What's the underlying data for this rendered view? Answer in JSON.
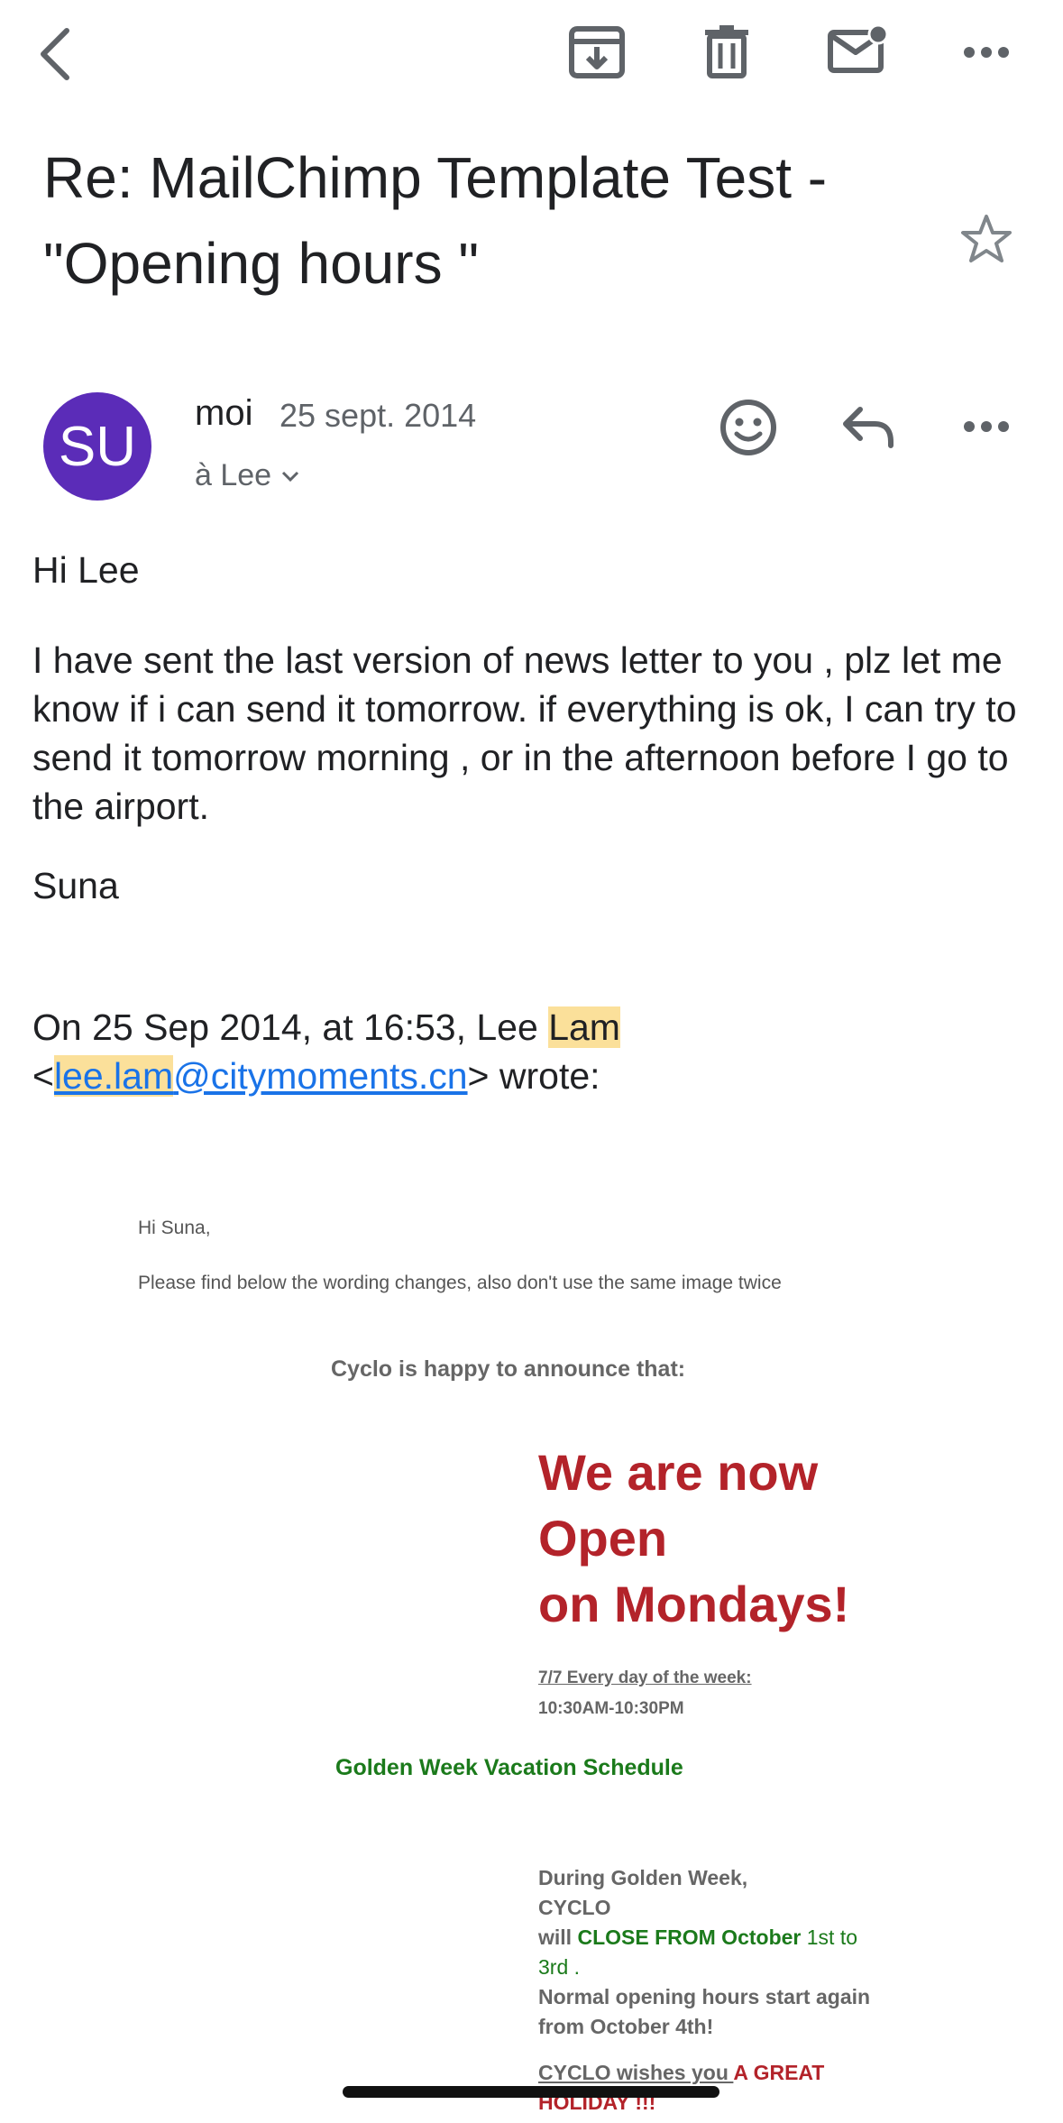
{
  "toolbar": {
    "back": "back-arrow-icon",
    "archive": "archive-icon",
    "delete": "trash-icon",
    "mark_unread": "mail-unread-icon",
    "more": "more-horizontal-icon"
  },
  "email": {
    "subject": "Re: MailChimp Template Test - \"Opening hours \"",
    "avatar_initials": "SU",
    "avatar_color": "#5b2cb8",
    "sender": "moi",
    "date": "25 sept. 2014",
    "recipient": "à Lee",
    "greeting": "Hi Lee",
    "paragraph": "I have sent the last version of news letter to you , plz let me know if i can send it tomorrow. if everything is ok, I can try to send it tomorrow morning , or in the afternoon before I go to the airport.",
    "signature": "Suna",
    "quote_header_prefix": "On 25 Sep 2014, at 16:53, Lee ",
    "quote_header_highlight": "Lam",
    "quote_open": "<",
    "quote_email_hl": "lee.lam",
    "quote_email_rest": "@citymoments.cn",
    "quote_close": "> wrote:"
  },
  "quoted": {
    "greeting": "Hi Suna,",
    "intro": "Please find below the wording changes, also don't use the same image twice",
    "announce": "Cyclo is happy to announce that:",
    "headline_1": "We are now",
    "headline_2": "Open",
    "headline_3": "on Mondays!",
    "hours_label": "7/7 Every day of the week:",
    "hours": "10:30AM-10:30PM",
    "golden_week_title": "Golden Week Vacation Schedule",
    "gw_1": "During Golden Week,",
    "gw_2": "CYCLO",
    "gw_3a": "will ",
    "gw_3b": "CLOSE FROM October",
    "gw_3c": " 1st to",
    "gw_4a": "3rd",
    "gw_4b": " .",
    "gw_5": "Normal opening hours start again",
    "gw_6": "from October 4th!",
    "gw_7a": "CYCLO wishes you ",
    "gw_7b": "A GREAT",
    "gw_8": "HOLIDAY !!!"
  },
  "actions": {
    "emoji": "emoji-react-icon",
    "reply": "reply-icon",
    "more": "more-horizontal-icon",
    "star": "star-icon"
  }
}
